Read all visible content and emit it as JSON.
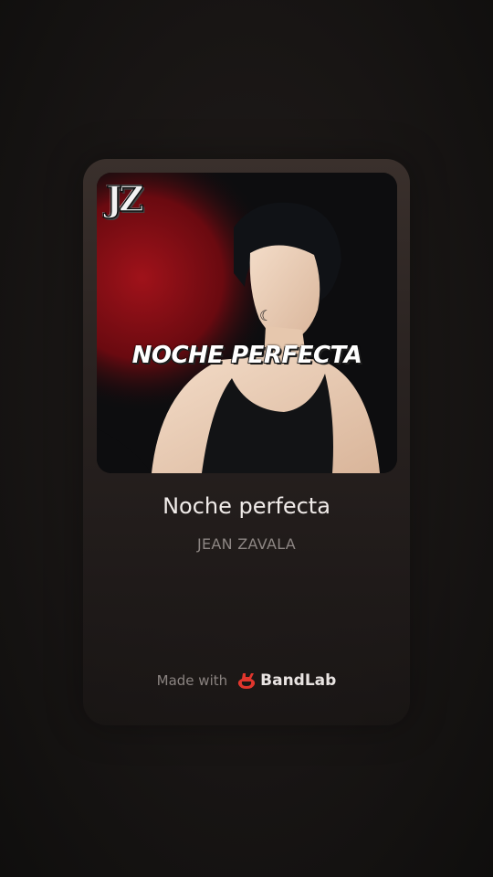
{
  "cover": {
    "logo_text": "JZ",
    "title_text": "NOCHE PERFECTA",
    "moon_glyph": "☾",
    "accent_color": "#9b0f16"
  },
  "track": {
    "title": "Noche perfecta",
    "artist": "JEAN ZAVALA"
  },
  "footer": {
    "made_with_label": "Made with",
    "brand_label": "BandLab",
    "brand_icon": "bandlab-logo-icon",
    "brand_color": "#e0362d"
  }
}
